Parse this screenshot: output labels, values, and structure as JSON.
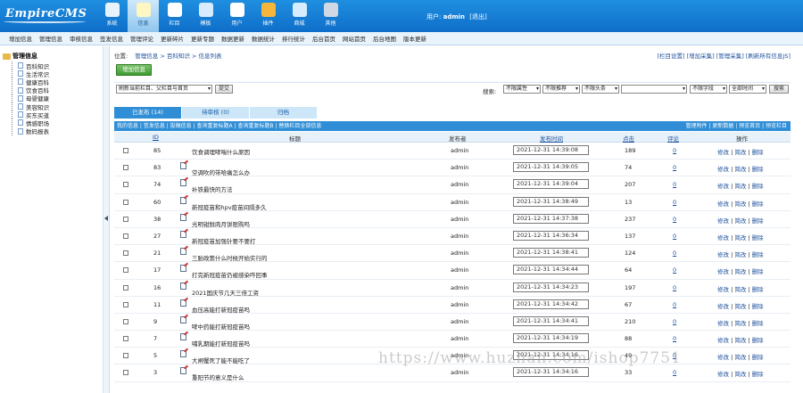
{
  "app": {
    "logo_text": "EmpireCMS"
  },
  "topnav": [
    {
      "label": "系统",
      "icon": "system-icon",
      "color": "#e8f2fb"
    },
    {
      "label": "信息",
      "icon": "edit-icon",
      "color": "#fff7c2",
      "active": true
    },
    {
      "label": "栏目",
      "icon": "folder-icon",
      "color": "#ffffff"
    },
    {
      "label": "模板",
      "icon": "template-icon",
      "color": "#d9ecff"
    },
    {
      "label": "用户",
      "icon": "user-icon",
      "color": "#ffffff"
    },
    {
      "label": "插件",
      "icon": "plugin-icon",
      "color": "#f6b63b"
    },
    {
      "label": "商城",
      "icon": "shop-icon",
      "color": "#d6ecff"
    },
    {
      "label": "其他",
      "icon": "gear-icon",
      "color": "#cfd8e3"
    }
  ],
  "user": {
    "prefix": "用户:",
    "name": "admin",
    "logout": "[退出]"
  },
  "menustrip": [
    "增加信息",
    "管理信息",
    "审核信息",
    "签发信息",
    "管理评论",
    "更新碎片",
    "更新专题",
    "数据更新",
    "数据统计",
    "排行统计",
    "后台首页",
    "网站首页",
    "后台地图",
    "版本更新"
  ],
  "sidebar": {
    "title": "管理信息",
    "items": [
      "百科知识",
      "生活常识",
      "健康百科",
      "饮食百科",
      "母婴健康",
      "美容知识",
      "买东买道",
      "情感职场",
      "数码报表"
    ]
  },
  "crumb": {
    "label": "位置:",
    "path": "管理信息 > 百科知识 > 信息列表",
    "right": "[栏目设置] [增加采集] [管理采集] [刷新所有信息JS]"
  },
  "add_button": "增加信息",
  "filter": {
    "refresh_select": "刷新当前栏目、父栏目与首页",
    "submit": "提交",
    "search_label": "搜索:",
    "sel1": "不限属性",
    "sel2": "不限推荐",
    "sel3": "不限头条",
    "search_value": "",
    "sel4": "不限字段",
    "sel5": "全部时间",
    "search_btn": "搜索"
  },
  "tabs": [
    {
      "label": "已发布 (14)",
      "active": true
    },
    {
      "label": "待审核 (0)",
      "active": false
    },
    {
      "label": "归档",
      "active": false
    }
  ],
  "sublinks": {
    "left": "我的信息 | 签发信息 | 投稿信息 | 查询重复标题A | 查询重复标题B | 替换栏目全部信息",
    "right": "管理附件 | 更新数据 | 预览首页 | 预览栏目"
  },
  "grid": {
    "headers": {
      "id": "ID",
      "title": "标题",
      "publisher": "发布者",
      "time": "发布时间",
      "clicks": "点击",
      "comments": "评论",
      "ops": "操作"
    },
    "ops": {
      "edit": "修改",
      "simple_edit": "简改",
      "delete": "删除",
      "sep": " | "
    },
    "rows": [
      {
        "id": "85",
        "title": "饮食调理哮喘什么原因",
        "publisher": "admin",
        "time": "2021-12-31 14:39:08",
        "clicks": "189",
        "comments": "0",
        "icon": false
      },
      {
        "id": "83",
        "title": "空调吹的带哈痛怎么办",
        "publisher": "admin",
        "time": "2021-12-31 14:39:05",
        "clicks": "74",
        "comments": "0",
        "icon": true
      },
      {
        "id": "74",
        "title": "补铁最快的方法",
        "publisher": "admin",
        "time": "2021-12-31 14:39:04",
        "clicks": "207",
        "comments": "0",
        "icon": true
      },
      {
        "id": "60",
        "title": "新冠疫苗和hpv疫苗间隔多久",
        "publisher": "admin",
        "time": "2021-12-31 14:38:49",
        "clicks": "13",
        "comments": "0",
        "icon": true
      },
      {
        "id": "38",
        "title": "光明钳鲜肉月饼限购吗",
        "publisher": "admin",
        "time": "2021-12-31 14:37:38",
        "clicks": "237",
        "comments": "0",
        "icon": true
      },
      {
        "id": "27",
        "title": "新冠疫苗加强针要不要打",
        "publisher": "admin",
        "time": "2021-12-31 14:36:34",
        "clicks": "137",
        "comments": "0",
        "icon": true
      },
      {
        "id": "21",
        "title": "三胎政策什么时候开始实行的",
        "publisher": "admin",
        "time": "2021-12-31 14:38:41",
        "clicks": "124",
        "comments": "0",
        "icon": true
      },
      {
        "id": "17",
        "title": "打完新冠疫苗仍被感染咋回事",
        "publisher": "admin",
        "time": "2021-12-31 14:34:44",
        "clicks": "64",
        "comments": "0",
        "icon": true
      },
      {
        "id": "16",
        "title": "2021国庆节几天三倍工资",
        "publisher": "admin",
        "time": "2021-12-31 14:34:23",
        "clicks": "197",
        "comments": "0",
        "icon": true
      },
      {
        "id": "11",
        "title": "血压高能打新冠疫苗吗",
        "publisher": "admin",
        "time": "2021-12-31 14:34:42",
        "clicks": "67",
        "comments": "0",
        "icon": true
      },
      {
        "id": "9",
        "title": "哮中药能打新冠疫苗吗",
        "publisher": "admin",
        "time": "2021-12-31 14:34:41",
        "clicks": "210",
        "comments": "0",
        "icon": true
      },
      {
        "id": "7",
        "title": "哺乳期能打新冠疫苗吗",
        "publisher": "admin",
        "time": "2021-12-31 14:34:19",
        "clicks": "88",
        "comments": "0",
        "icon": true
      },
      {
        "id": "5",
        "title": "大闸蟹死了能不能吃了",
        "publisher": "admin",
        "time": "2021-12-31 14:34:16",
        "clicks": "49",
        "comments": "0",
        "icon": true
      },
      {
        "id": "3",
        "title": "重阳节的意义是什么",
        "publisher": "admin",
        "time": "2021-12-31 14:34:16",
        "clicks": "33",
        "comments": "0",
        "icon": true
      }
    ]
  },
  "watermark": "https://www.huzhan.com/ishop7751"
}
